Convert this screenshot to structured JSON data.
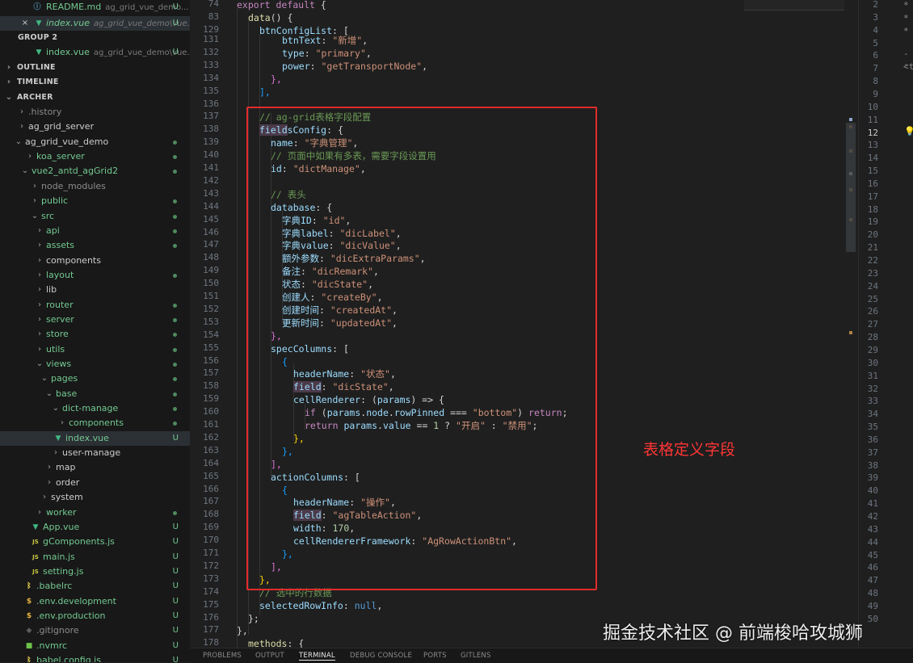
{
  "sidebar": {
    "open_editors": [
      {
        "label": "README.md",
        "desc": "ag_grid_vue_demo...",
        "status": "U",
        "icon": "info-icon"
      },
      {
        "label": "index.vue",
        "desc": "ag_grid_vue_demo\\vue...",
        "status": "U",
        "icon": "vue-file-icon",
        "italic": true
      }
    ],
    "group2_label": "GROUP 2",
    "group2_file": {
      "label": "index.vue",
      "desc": "ag_grid_vue_demo\\vue...",
      "status": "U"
    },
    "outline_label": "OUTLINE",
    "timeline_label": "TIMELINE",
    "archer_label": "ARCHER",
    "tree": [
      {
        "label": ".history",
        "status": ""
      },
      {
        "label": "ag_grid_server",
        "status": ""
      },
      {
        "label": "ag_grid_vue_demo",
        "status": "dot"
      },
      {
        "label": "koa_server",
        "status": "dot"
      },
      {
        "label": "vue2_antd_agGrid2",
        "status": "dot"
      },
      {
        "label": "node_modules",
        "status": ""
      },
      {
        "label": "public",
        "status": "dot"
      },
      {
        "label": "src",
        "status": "dot"
      },
      {
        "label": "api",
        "status": "dot"
      },
      {
        "label": "assets",
        "status": "dot"
      },
      {
        "label": "components",
        "status": ""
      },
      {
        "label": "layout",
        "status": "dot"
      },
      {
        "label": "lib",
        "status": ""
      },
      {
        "label": "router",
        "status": "dot"
      },
      {
        "label": "server",
        "status": "dot"
      },
      {
        "label": "store",
        "status": "dot"
      },
      {
        "label": "utils",
        "status": "dot"
      },
      {
        "label": "views",
        "status": "dot"
      },
      {
        "label": "pages",
        "status": "dot"
      },
      {
        "label": "base",
        "status": "dot"
      },
      {
        "label": "dict-manage",
        "status": "dot"
      },
      {
        "label": "components",
        "status": "dot"
      },
      {
        "label": "index.vue",
        "status": "U"
      },
      {
        "label": "user-manage",
        "status": ""
      },
      {
        "label": "map",
        "status": ""
      },
      {
        "label": "order",
        "status": ""
      },
      {
        "label": "system",
        "status": ""
      },
      {
        "label": "worker",
        "status": "dot"
      },
      {
        "label": "App.vue",
        "status": "U"
      },
      {
        "label": "gComponents.js",
        "status": "U"
      },
      {
        "label": "main.js",
        "status": "U"
      },
      {
        "label": "setting.js",
        "status": "U"
      },
      {
        "label": ".babelrc",
        "status": "U"
      },
      {
        "label": ".env.development",
        "status": "U"
      },
      {
        "label": ".env.production",
        "status": "U"
      },
      {
        "label": ".gitignore",
        "status": "U"
      },
      {
        "label": ".nvmrc",
        "status": "U"
      },
      {
        "label": "babel.config.js",
        "status": "U"
      }
    ]
  },
  "editor": {
    "sticky_lines": [
      "74",
      "83",
      "129"
    ],
    "line_numbers": [
      "131",
      "132",
      "133",
      "134",
      "135",
      "136",
      "137",
      "138",
      "139",
      "140",
      "141",
      "142",
      "143",
      "144",
      "145",
      "146",
      "147",
      "148",
      "149",
      "150",
      "151",
      "152",
      "153",
      "154",
      "155",
      "156",
      "157",
      "158",
      "159",
      "160",
      "161",
      "162",
      "163",
      "164",
      "165",
      "166",
      "167",
      "168",
      "169",
      "170",
      "171",
      "172",
      "173",
      "174",
      "175",
      "176",
      "177",
      "178"
    ],
    "code": {
      "l74_a": "export",
      "l74_b": "default",
      "l83_a": "data",
      "l83_b": "() {",
      "l129_a": "btnConfigList",
      "l129_b": ": [",
      "l131_a": "btnText",
      "l131_b": ": ",
      "l131_c": "\"新增\"",
      "l131_d": ",",
      "l132_a": "type",
      "l132_b": ": ",
      "l132_c": "\"primary\"",
      "l132_d": ",",
      "l133_a": "power",
      "l133_b": ": ",
      "l133_c": "\"getTransportNode\"",
      "l133_d": ",",
      "l134": "},",
      "l135": "],",
      "l137": "// ag-grid表格字段配置",
      "l138_a": "field",
      "l138_b": "sConfig",
      "l138_c": ": {",
      "l139_a": "name",
      "l139_b": ": ",
      "l139_c": "\"字典管理\"",
      "l139_d": ",",
      "l140": "// 页面中如果有多表，需要字段设置用",
      "l141_a": "id",
      "l141_b": ": ",
      "l141_c": "\"dictManage\"",
      "l141_d": ",",
      "l143": "// 表头",
      "l144_a": "database",
      "l144_b": ": {",
      "l145_a": "字典ID",
      "l145_c": "\"id\"",
      "l146_a": "字典label",
      "l146_c": "\"dicLabel\"",
      "l147_a": "字典value",
      "l147_c": "\"dicValue\"",
      "l148_a": "额外参数",
      "l148_c": "\"dicExtraParams\"",
      "l149_a": "备注",
      "l149_c": "\"dicRemark\"",
      "l150_a": "状态",
      "l150_c": "\"dicState\"",
      "l151_a": "创建人",
      "l151_c": "\"createBy\"",
      "l152_a": "创建时间",
      "l152_c": "\"createdAt\"",
      "l153_a": "更新时间",
      "l153_c": "\"updatedAt\"",
      "l154": "},",
      "l155_a": "specColumns",
      "l155_b": ": [",
      "l156": "{",
      "l157_a": "headerName",
      "l157_c": "\"状态\"",
      "l158_a": "field",
      "l158_c": "\"dicState\"",
      "l159_a": "cellRenderer",
      "l159_b": ": (",
      "l159_c": "params",
      "l159_d": ") => {",
      "l160_a": "if",
      "l160_b": " (",
      "l160_c": "params",
      "l160_d": ".",
      "l160_e": "node",
      "l160_f": ".",
      "l160_g": "rowPinned",
      "l160_h": " === ",
      "l160_i": "\"bottom\"",
      "l160_j": ") ",
      "l160_k": "return",
      "l160_l": ";",
      "l161_a": "return",
      "l161_b": " ",
      "l161_c": "params",
      "l161_d": ".",
      "l161_e": "value",
      "l161_f": " == ",
      "l161_g": "1",
      "l161_h": " ? ",
      "l161_i": "\"开启\"",
      "l161_j": " : ",
      "l161_k": "\"禁用\"",
      "l161_l": ";",
      "l162": "},",
      "l163": "},",
      "l164": "],",
      "l165_a": "actionColumns",
      "l165_b": ": [",
      "l166": "{",
      "l167_a": "headerName",
      "l167_c": "\"操作\"",
      "l168_a": "field",
      "l168_c": "\"agTableAction\"",
      "l169_a": "width",
      "l169_c": "170",
      "l170_a": "cellRendererFramework",
      "l170_c": "\"AgRowActionBtn\"",
      "l171": "},",
      "l172": "],",
      "l173": "},",
      "l174": "// 选中的行数据",
      "l175_a": "selectedRowInfo",
      "l175_b": ": ",
      "l175_c": "null",
      "l175_d": ",",
      "l176": "};",
      "l177": "},",
      "l178_a": "methods",
      "l178_b": ": {",
      "colon": ": ",
      "comma": ","
    }
  },
  "annotation_text": "表格定义字段",
  "watermark_text": "掘金技术社区 @ 前端梭哈攻城狮",
  "right_split": {
    "line_numbers": [
      "2",
      "3",
      "4",
      "5",
      "6",
      "7",
      "8",
      "9",
      "10",
      "11",
      "12",
      "13",
      "14",
      "15",
      "16",
      "17",
      "18",
      "19",
      "20",
      "21",
      "22",
      "23",
      "24",
      "25",
      "26",
      "27",
      "28",
      "29",
      "30",
      "31",
      "32",
      "33",
      "34",
      "35",
      "36",
      "37",
      "38",
      "39",
      "40",
      "41",
      "42",
      "43",
      "44",
      "45",
      "46",
      "47",
      "48",
      "49",
      "50"
    ],
    "current_line": "12",
    "text_tag": "<t",
    "text_dashes": "--"
  },
  "panel_tabs": [
    "PROBLEMS",
    "OUTPUT",
    "TERMINAL",
    "DEBUG CONSOLE",
    "PORTS",
    "GITLENS"
  ],
  "active_panel_tab": "TERMINAL",
  "colors": {
    "annotation_box": "#e22b2b",
    "annotation_text": "#ff3535",
    "untracked": "#73c991",
    "vue_icon": "#41b883",
    "js_icon": "#cbcb41"
  }
}
